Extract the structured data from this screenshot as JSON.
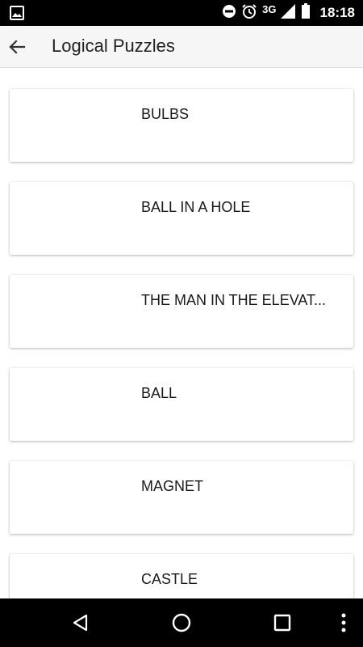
{
  "status_bar": {
    "network": "3G",
    "time": "18:18",
    "icons": [
      "image-icon",
      "do-not-disturb-icon",
      "alarm-icon",
      "signal-icon",
      "battery-icon"
    ]
  },
  "app_bar": {
    "title": "Logical Puzzles",
    "back_icon": "arrow-back-icon"
  },
  "puzzles": [
    {
      "title": "BULBS"
    },
    {
      "title": "BALL IN A HOLE"
    },
    {
      "title": "THE MAN IN THE ELEVAT..."
    },
    {
      "title": "BALL"
    },
    {
      "title": "MAGNET"
    },
    {
      "title": "CASTLE"
    }
  ],
  "nav_bar": {
    "icons": [
      "back-triangle-icon",
      "home-circle-icon",
      "recents-square-icon",
      "more-vert-icon"
    ]
  },
  "colors": {
    "status_bar_bg": "#000000",
    "app_bar_bg": "#f6f6f6",
    "card_bg": "#ffffff",
    "nav_bar_bg": "#000000"
  }
}
